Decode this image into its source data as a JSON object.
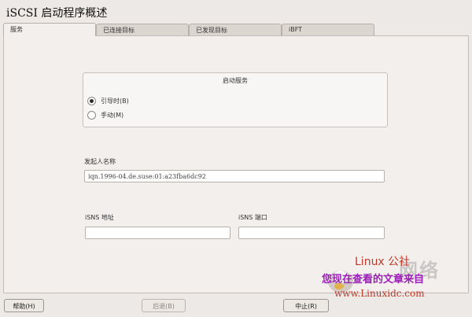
{
  "window": {
    "title": "iSCSI 启动程序概述"
  },
  "tabs": [
    {
      "label": "服务",
      "active": true
    },
    {
      "label": "已连接目标",
      "active": false
    },
    {
      "label": "已发现目标",
      "active": false
    },
    {
      "label": "iBFT",
      "active": false
    }
  ],
  "service": {
    "group_title": "启动服务",
    "options": [
      {
        "label": "引导时(B)",
        "checked": true
      },
      {
        "label": "手动(M)",
        "checked": false
      }
    ]
  },
  "initiator": {
    "label": "发起人名称",
    "value": "iqn.1996-04.de.suse:01:a23fba6dc92"
  },
  "isns": {
    "address_label": "iSNS 地址",
    "address_value": "",
    "port_label": "iSNS 端口",
    "port_value": ""
  },
  "buttons": {
    "help": "帮助(H)",
    "back": "后退(B)",
    "abort": "中止(R)"
  },
  "watermark": {
    "line1": "Linux 公社",
    "line2": "您现在查看的文章来自",
    "url": "www.Linuxidc.com",
    "bg": "网络"
  }
}
